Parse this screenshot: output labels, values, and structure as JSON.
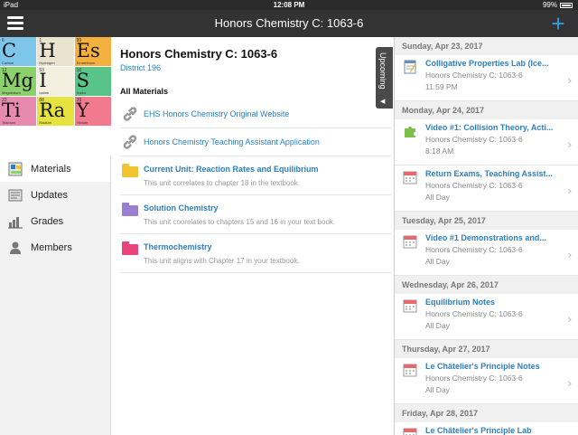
{
  "status_bar": {
    "carrier": "iPad",
    "time": "12:08 PM",
    "battery": "99%"
  },
  "header": {
    "title": "Honors Chemistry C: 1063-6"
  },
  "sidebar": {
    "elements": [
      {
        "num": "6",
        "sym": "C",
        "sub": "Carbon",
        "color": "#7dc6e9"
      },
      {
        "num": "1",
        "sym": "H",
        "sub": "Hydrogen",
        "color": "#e9e3cf"
      },
      {
        "num": "99",
        "sym": "Es",
        "sub": "Einsteinium",
        "color": "#f4b03f"
      },
      {
        "num": "12",
        "sym": "Mg",
        "sub": "Magnesium",
        "color": "#8bd06a"
      },
      {
        "num": "53",
        "sym": "I",
        "sub": "Iodine",
        "color": "#f4f0e0"
      },
      {
        "num": "16",
        "sym": "S",
        "sub": "Sulfur",
        "color": "#58c487"
      },
      {
        "num": "22",
        "sym": "Ti",
        "sub": "Titanium",
        "color": "#e88aae"
      },
      {
        "num": "88",
        "sym": "Ra",
        "sub": "Radium",
        "color": "#e6e23e"
      },
      {
        "num": "39",
        "sym": "Y",
        "sub": "Yttrium",
        "color": "#f27a8f"
      }
    ],
    "items": [
      {
        "label": "Materials",
        "icon": "materials-icon"
      },
      {
        "label": "Updates",
        "icon": "updates-icon"
      },
      {
        "label": "Grades",
        "icon": "grades-icon"
      },
      {
        "label": "Members",
        "icon": "members-icon"
      }
    ]
  },
  "main": {
    "course_title": "Honors Chemistry C: 1063-6",
    "district": "District 196",
    "section_label": "All Materials",
    "materials": [
      {
        "name": "EHS Honors Chemistry Original Website",
        "type": "link"
      },
      {
        "name": "Honors Chemistry Teaching Assistant Application",
        "type": "link"
      },
      {
        "name": "Current Unit: Reaction Rates and Equilibrium",
        "desc": "This unit correlates to chapter 18 in the textbook.",
        "type": "folder",
        "color": "#f2c530"
      },
      {
        "name": "Solution Chemistry",
        "desc": "This unit coorelates to chapters 15 and 16 in your text book.",
        "type": "folder",
        "color": "#9b7fd3"
      },
      {
        "name": "Thermochemistry",
        "desc": "This unit aligns with Chapter 17 in your textbook.",
        "type": "folder",
        "color": "#e8457a"
      }
    ]
  },
  "upcoming_tab": {
    "label": "Upcoming"
  },
  "upcoming": {
    "days": [
      {
        "date": "Sunday, Apr 23, 2017",
        "events": [
          {
            "title": "Colligative Properties Lab (Ice...",
            "course": "Honors Chemistry C: 1063-6",
            "time": "11:59 PM",
            "icon": "assignment-icon"
          }
        ]
      },
      {
        "date": "Monday, Apr 24, 2017",
        "events": [
          {
            "title": "Video #1: Collision Theory, Acti...",
            "course": "Honors Chemistry C: 1063-6",
            "time": "8:18 AM",
            "icon": "puzzle-icon"
          },
          {
            "title": "Return Exams, Teaching Assist...",
            "course": "Honors Chemistry C: 1063-6",
            "time": "All Day",
            "icon": "calendar-icon"
          }
        ]
      },
      {
        "date": "Tuesday, Apr 25, 2017",
        "events": [
          {
            "title": "Video #1 Demonstrations and...",
            "course": "Honors Chemistry C: 1063-6",
            "time": "All Day",
            "icon": "calendar-icon"
          }
        ]
      },
      {
        "date": "Wednesday, Apr 26, 2017",
        "events": [
          {
            "title": "Equilibrium Notes",
            "course": "Honors Chemistry C: 1063-6",
            "time": "All Day",
            "icon": "calendar-icon"
          }
        ]
      },
      {
        "date": "Thursday, Apr 27, 2017",
        "events": [
          {
            "title": "Le Châtelier's Principle Notes",
            "course": "Honors Chemistry C: 1063-6",
            "time": "All Day",
            "icon": "calendar-icon"
          }
        ]
      },
      {
        "date": "Friday, Apr 28, 2017",
        "events": [
          {
            "title": "Le Châtelier's Principle Lab",
            "course": "",
            "time": "",
            "icon": "calendar-icon"
          }
        ]
      }
    ]
  }
}
